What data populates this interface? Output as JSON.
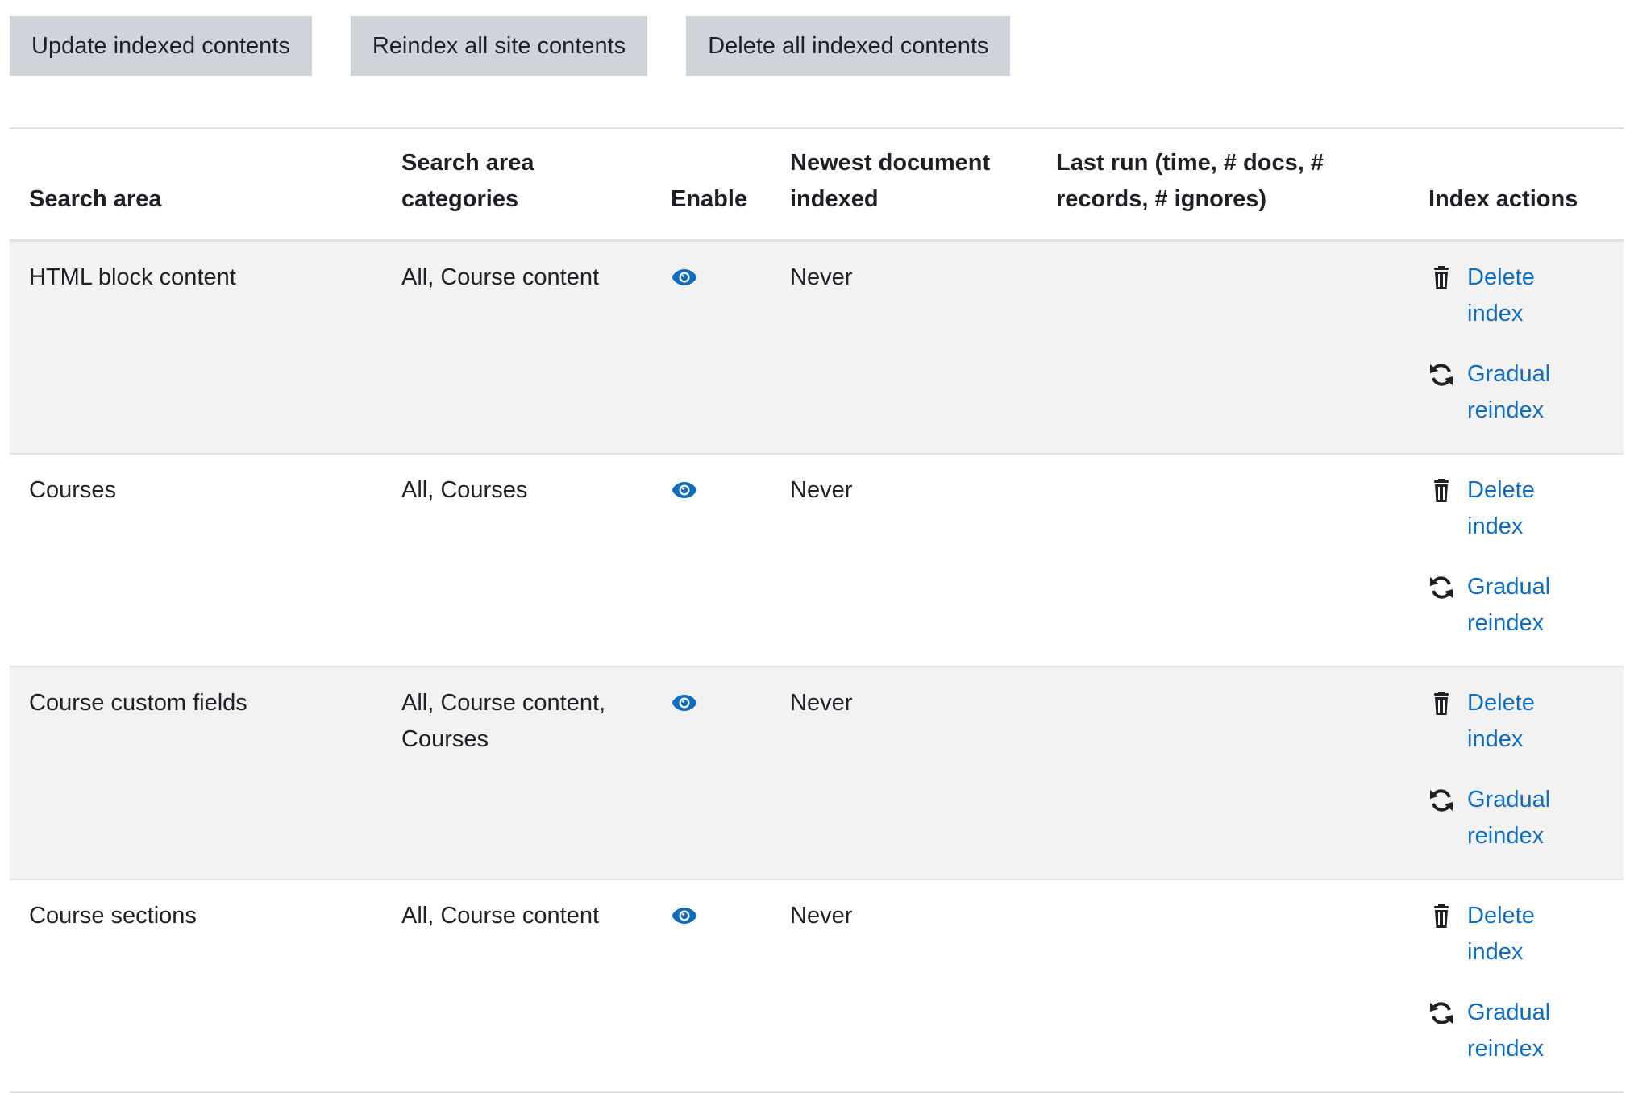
{
  "toolbar": {
    "update_label": "Update indexed contents",
    "reindex_label": "Reindex all site contents",
    "delete_label": "Delete all indexed contents"
  },
  "table": {
    "headers": {
      "area": "Search area",
      "categories": "Search area categories",
      "enable": "Enable",
      "newest": "Newest document indexed",
      "lastrun": "Last run (time, # docs, # records, # ignores)",
      "actions": "Index actions"
    },
    "rows": [
      {
        "area": "HTML block content",
        "categories": "All, Course content",
        "newest": "Never",
        "lastrun": "",
        "delete_label": "Delete index",
        "reindex_label": "Gradual reindex"
      },
      {
        "area": "Courses",
        "categories": "All, Courses",
        "newest": "Never",
        "lastrun": "",
        "delete_label": "Delete index",
        "reindex_label": "Gradual reindex"
      },
      {
        "area": "Course custom fields",
        "categories": "All, Course content, Courses",
        "newest": "Never",
        "lastrun": "",
        "delete_label": "Delete index",
        "reindex_label": "Gradual reindex"
      },
      {
        "area": "Course sections",
        "categories": "All, Course content",
        "newest": "Never",
        "lastrun": "",
        "delete_label": "Delete index",
        "reindex_label": "Gradual reindex"
      }
    ]
  },
  "colors": {
    "link": "#0f6cbf",
    "button_bg": "#ced4da",
    "stripe": "#f2f2f2",
    "border": "#dee2e6"
  },
  "icons": {
    "enable": "eye-icon",
    "delete": "trash-icon",
    "reindex": "refresh-icon"
  }
}
